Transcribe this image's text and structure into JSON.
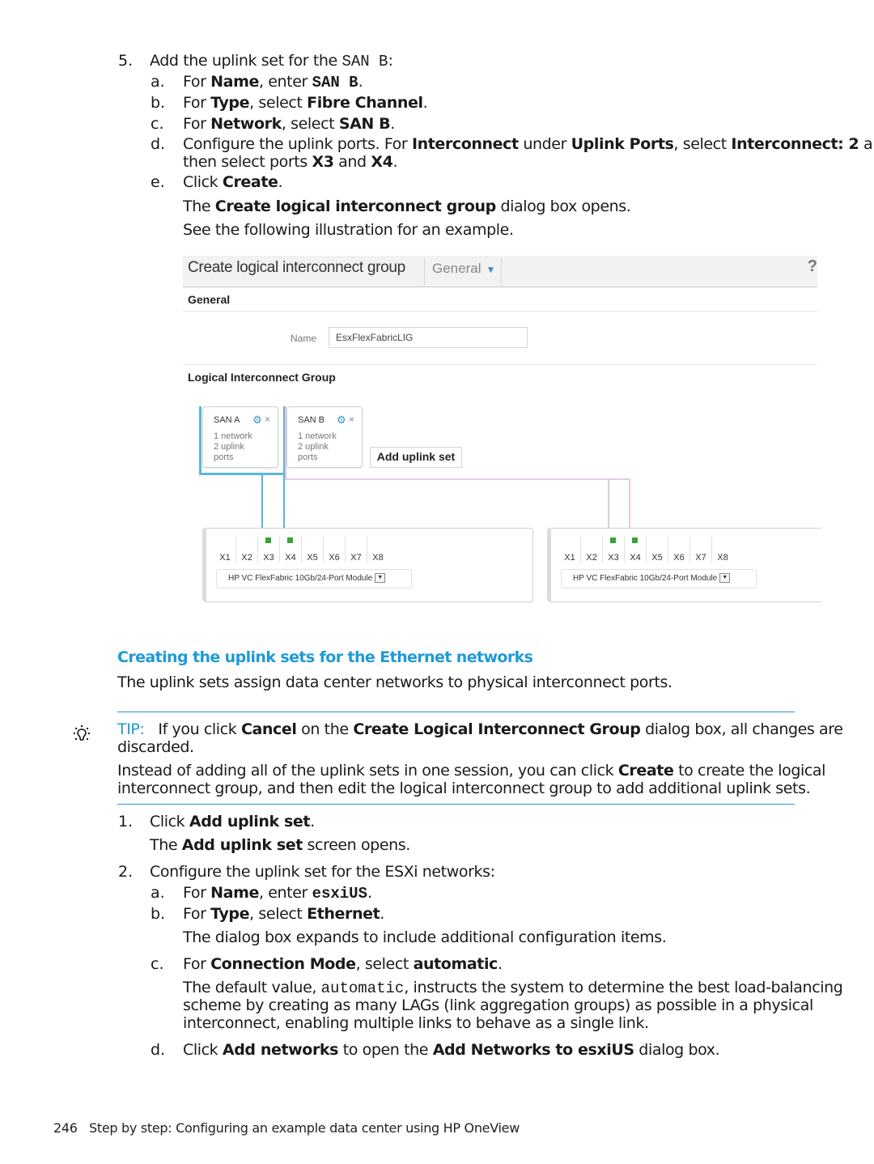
{
  "step5": {
    "num": "5.",
    "text_pre": "Add the uplink set for the ",
    "text_code": "SAN B",
    "text_post": ":",
    "substeps": [
      {
        "letter": "a.",
        "pre": "For ",
        "bold1": "Name",
        "mid": ", enter ",
        "code": "SAN B",
        "post": "."
      },
      {
        "letter": "b.",
        "pre": "For ",
        "bold1": "Type",
        "mid": ", select ",
        "bold2": "Fibre Channel",
        "post": "."
      },
      {
        "letter": "c.",
        "pre": "For ",
        "bold1": "Network",
        "mid": ", select ",
        "bold2": "SAN B",
        "post": "."
      },
      {
        "letter": "d.",
        "pre": "Configure the uplink ports. For ",
        "bold1": "Interconnect",
        "mid": " under ",
        "bold2": "Uplink Ports",
        "mid2": ", select ",
        "bold3": "Interconnect: 2",
        "post": " and",
        "line2_pre": "then select ports ",
        "line2_b1": "X3",
        "line2_mid": " and ",
        "line2_b2": "X4",
        "line2_post": "."
      },
      {
        "letter": "e.",
        "pre": "Click ",
        "bold1": "Create",
        "post": "."
      }
    ],
    "note1_pre": "The ",
    "note1_bold": "Create logical interconnect group",
    "note1_post": " dialog box opens.",
    "note2": "See the following illustration for an example."
  },
  "dialog": {
    "title": "Create logical interconnect group",
    "nav_label": "General",
    "help": "?",
    "general_heading": "General",
    "name_label": "Name",
    "name_value": "EsxFlexFabricLIG",
    "lig_heading": "Logical Interconnect Group",
    "uplink_sets": [
      {
        "name": "SAN A",
        "desc": "1 network\n2 uplink\nports",
        "color": "#5ab6dd"
      },
      {
        "name": "SAN B",
        "desc": "1 network\n2 uplink\nports",
        "color": "#e3c9e3"
      }
    ],
    "add_uplink_label": "Add uplink set",
    "modules": [
      {
        "ports": [
          "X1",
          "X2",
          "X3",
          "X4",
          "X5",
          "X6",
          "X7",
          "X8"
        ],
        "active_ports": [
          "X3",
          "X4"
        ],
        "type": "HP VC FlexFabric 10Gb/24-Port Module"
      },
      {
        "ports": [
          "X1",
          "X2",
          "X3",
          "X4",
          "X5",
          "X6",
          "X7",
          "X8"
        ],
        "active_ports": [
          "X3",
          "X4"
        ],
        "type": "HP VC FlexFabric 10Gb/24-Port Module"
      }
    ],
    "gear_icon": "⚙",
    "close_icon": "×",
    "dropdown_icon": "▼",
    "chevron_icon": "⌄"
  },
  "section": {
    "heading": "Creating the uplink sets for the Ethernet networks",
    "intro": "The uplink sets assign data center networks to physical interconnect ports."
  },
  "tip": {
    "label": "TIP:",
    "p1_pre": "If you click ",
    "p1_b1": "Cancel",
    "p1_mid": " on the ",
    "p1_b2": "Create Logical Interconnect Group",
    "p1_post": " dialog box, all changes are",
    "p1_line2": "discarded.",
    "p2_pre": "Instead of adding all of the uplink sets in one session, you can click ",
    "p2_b": "Create",
    "p2_post": " to create the logical",
    "p2_line2": "interconnect group, and then edit the logical interconnect group to add additional uplink sets."
  },
  "steps": {
    "s1": {
      "num": "1.",
      "pre": "Click ",
      "bold": "Add uplink set",
      "post": ".",
      "note_pre": "The ",
      "note_bold": "Add uplink set",
      "note_post": " screen opens."
    },
    "s2": {
      "num": "2.",
      "text": "Configure the uplink set for the ESXi networks:",
      "a": {
        "letter": "a.",
        "pre": "For ",
        "bold": "Name",
        "mid": ", enter ",
        "code": "esxiUS",
        "post": "."
      },
      "b": {
        "letter": "b.",
        "pre": "For ",
        "bold": "Type",
        "mid": ", select ",
        "bold2": "Ethernet",
        "post": ".",
        "note": "The dialog box expands to include additional configuration items."
      },
      "c": {
        "letter": "c.",
        "pre": "For ",
        "bold": "Connection Mode",
        "mid": ", select ",
        "bold2": "automatic",
        "post": ".",
        "note_pre": "The default value, ",
        "note_code": "automatic",
        "note_post": ", instructs the system to determine the best load-balancing",
        "note_line2": "scheme by creating as many LAGs (link aggregation groups) as possible in a physical",
        "note_line3": "interconnect, enabling multiple links to behave as a single link."
      },
      "d": {
        "letter": "d.",
        "pre": "Click ",
        "bold": "Add networks",
        "mid": " to open the ",
        "bold2": "Add Networks to esxiUS",
        "post": " dialog box."
      }
    }
  },
  "footer": {
    "page_number": "246",
    "title": "Step by step: Configuring an example data center using HP OneView"
  },
  "colors": {
    "accent": "#1f9ad6",
    "port_active": "#3aa33a",
    "san_a_line": "#5ab6dd",
    "san_b_line": "#e3c9e3"
  }
}
